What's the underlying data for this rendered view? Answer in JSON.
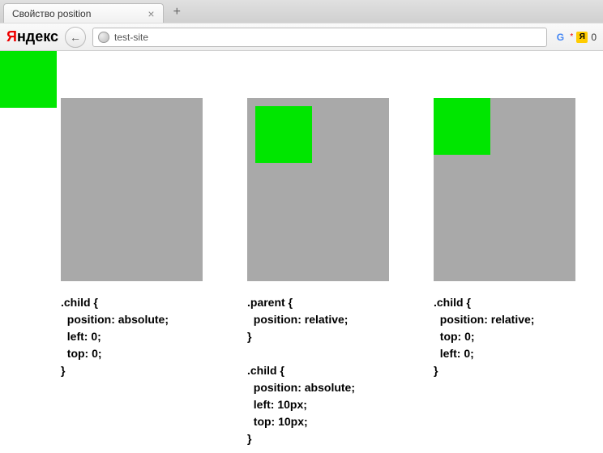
{
  "browser": {
    "tab_title": "Свойство position",
    "close_label": "×",
    "new_tab_label": "+",
    "yandex_red": "Я",
    "yandex_black": "ндекс",
    "back_arrow": "←",
    "url": "test-site",
    "ext_star": "*",
    "ext_count": "0"
  },
  "examples": {
    "ex1": {
      "code": ".child {\n  position: absolute;\n  left: 0;\n  top: 0;\n}"
    },
    "ex2": {
      "code": ".parent {\n  position: relative;\n}\n\n.child {\n  position: absolute;\n  left: 10px;\n  top: 10px;\n}"
    },
    "ex3": {
      "code": ".child {\n  position: relative;\n  top: 0;\n  left: 0;\n}"
    }
  }
}
